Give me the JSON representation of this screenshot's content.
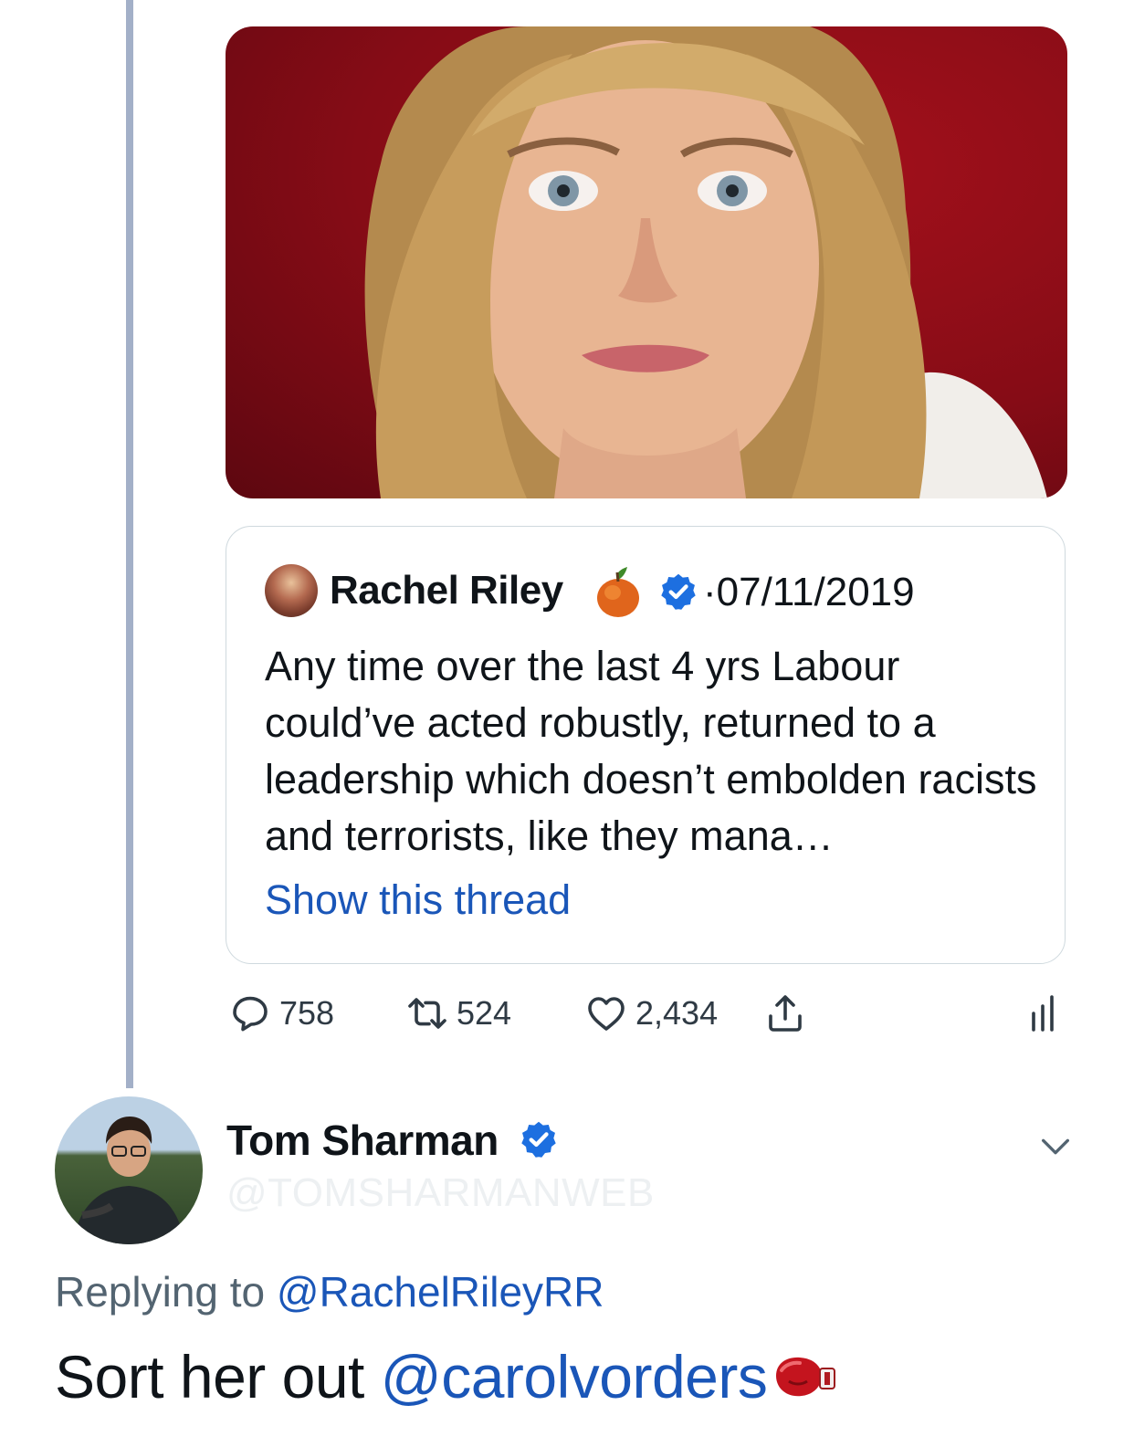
{
  "quoted_tweet": {
    "author_name": "Rachel Riley",
    "date_separator": "·",
    "date": "07/11/2019",
    "text": "Any time over the last 4 yrs Labour could’ve acted robustly, returned to a leadership which doesn’t embolden racists and terrorists, like they mana…",
    "show_thread_label": "Show this thread",
    "author_emoji": "peach-icon",
    "verified": true
  },
  "actions": {
    "replies": "758",
    "retweets": "524",
    "likes": "2,434"
  },
  "reply": {
    "author_name": "Tom Sharman",
    "handle": "@TOMSHARMANWEB",
    "verified": true,
    "replying_prefix": "Replying to",
    "replying_to": "@RachelRileyRR",
    "text_before": "Sort her out",
    "mention": "@carolvorders",
    "trailing_emoji": "boxing-glove-icon"
  },
  "colors": {
    "link": "#1a56b8",
    "thread_line": "#a3b0c8",
    "verified": "#1d6fe0",
    "photo_background": "#8b0d16"
  }
}
